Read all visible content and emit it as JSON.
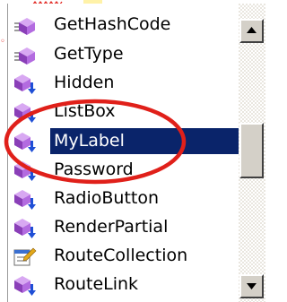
{
  "intellisense": {
    "items": [
      {
        "label": "GetHashCode",
        "icon": "method-icon"
      },
      {
        "label": "GetType",
        "icon": "method-icon"
      },
      {
        "label": "Hidden",
        "icon": "extension-method-icon"
      },
      {
        "label": "ListBox",
        "icon": "extension-method-icon"
      },
      {
        "label": "MyLabel",
        "icon": "extension-method-icon"
      },
      {
        "label": "Password",
        "icon": "extension-method-icon"
      },
      {
        "label": "RadioButton",
        "icon": "extension-method-icon"
      },
      {
        "label": "RenderPartial",
        "icon": "extension-method-icon"
      },
      {
        "label": "RouteCollection",
        "icon": "property-icon"
      },
      {
        "label": "RouteLink",
        "icon": "extension-method-icon"
      }
    ],
    "selected_index": 4,
    "scroll_position_fraction": 0.48
  },
  "colors": {
    "selection": "#0a246a",
    "annotation_circle": "#e0201a",
    "method_icon": "#9b4fc9",
    "extension_arrow": "#1f4fd6"
  }
}
